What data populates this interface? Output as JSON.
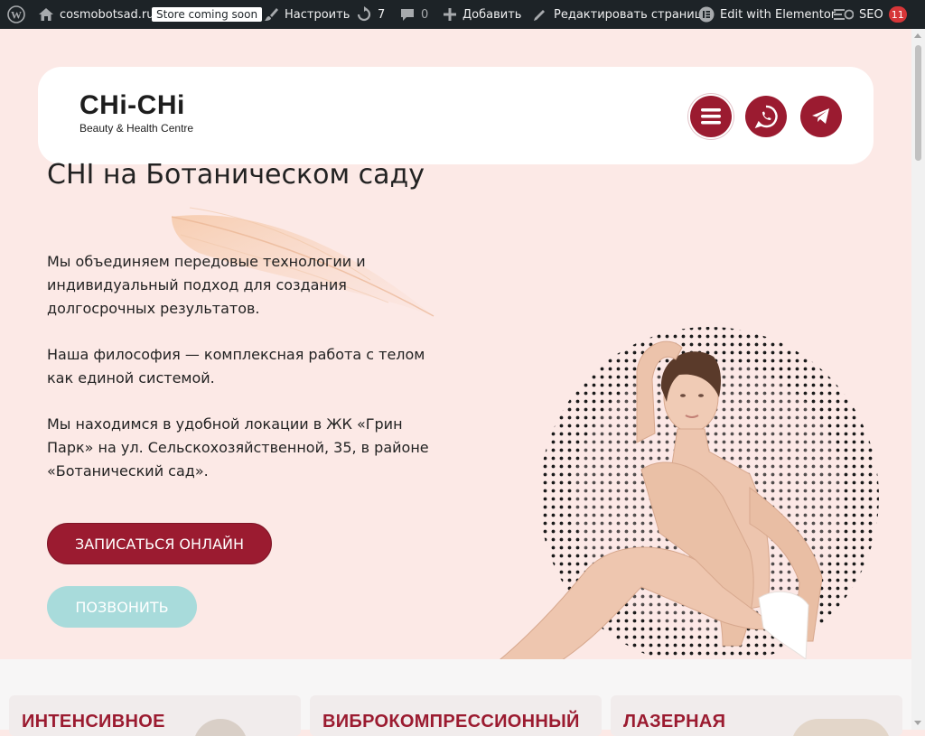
{
  "admin_bar": {
    "site_name": "cosmobotsad.ru",
    "store_badge": "Store coming soon",
    "customize": "Настроить",
    "updates_count": "7",
    "comments_count": "0",
    "add_new": "Добавить",
    "edit_page": "Редактировать страницу",
    "elementor": "Edit with Elementor",
    "seo": "SEO",
    "seo_count": "11"
  },
  "header": {
    "logo_mark": "CHi-CHi",
    "logo_sub": "Beauty & Health Centre",
    "icons": [
      "menu-icon",
      "whatsapp-icon",
      "telegram-icon"
    ]
  },
  "hero": {
    "title": "CHI на Ботаническом саду",
    "p1": "Мы объединяем передовые технологии и индивидуальный подход для создания долгосрочных результатов.",
    "p2": "Наша философия — комплексная работа с телом как единой системой.",
    "p3": "Мы находимся в удобной локации в ЖК «Грин Парк» на ул. Сельскохозяйственной, 35, в районе «Ботанический сад».",
    "book_button": "ЗАПИСАТЬСЯ ОНЛАЙН",
    "call_button": "ПОЗВОНИТЬ"
  },
  "services": [
    {
      "title": "ИНТЕНСИВНОЕ"
    },
    {
      "title": "ВИБРОКОМПРЕССИОННЫЙ"
    },
    {
      "title": "ЛАЗЕРНАЯ"
    }
  ],
  "colors": {
    "brand": "#9b1b30",
    "accent_teal": "#a8dbdb",
    "hero_bg": "#fce9e6",
    "admin_bar": "#1d2327"
  }
}
